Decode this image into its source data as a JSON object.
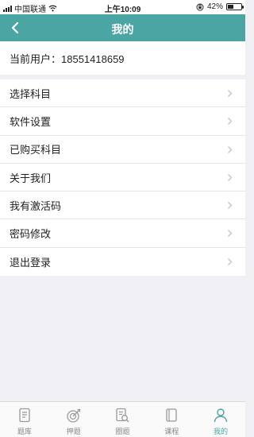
{
  "status_bar": {
    "carrier": "中国联通",
    "time": "上午10:09",
    "battery": "42%",
    "battery_level": 0.42
  },
  "header": {
    "title": "我的"
  },
  "user": {
    "label": "当前用户：18551418659"
  },
  "menu": {
    "items": [
      {
        "label": "选择科目"
      },
      {
        "label": "软件设置"
      },
      {
        "label": "已购买科目"
      },
      {
        "label": "关于我们"
      },
      {
        "label": "我有激活码"
      },
      {
        "label": "密码修改"
      },
      {
        "label": "退出登录"
      }
    ]
  },
  "tabs": [
    {
      "label": "题库",
      "icon": "document-icon"
    },
    {
      "label": "押题",
      "icon": "target-icon"
    },
    {
      "label": "圈题",
      "icon": "search-doc-icon"
    },
    {
      "label": "课程",
      "icon": "book-icon"
    },
    {
      "label": "我的",
      "icon": "user-icon"
    }
  ],
  "colors": {
    "accent": "#4aa5a3",
    "background": "#efeff4"
  }
}
